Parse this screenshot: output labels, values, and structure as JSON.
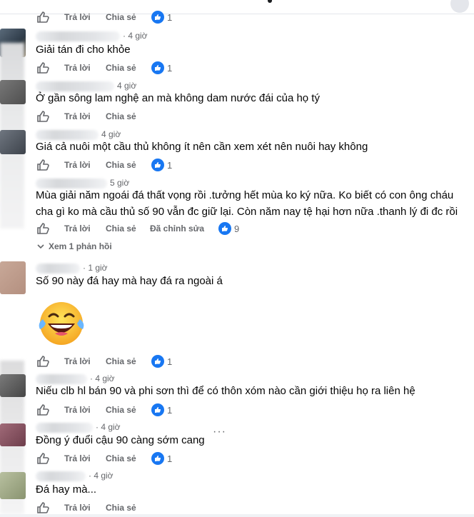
{
  "actions": {
    "reply": "Trả lời",
    "share": "Chia sẻ",
    "edited": "Đã chỉnh sửa"
  },
  "top": {
    "like_count": "1"
  },
  "comments": [
    {
      "time": "· 4 giờ",
      "text": "Giải tán đi cho khỏe",
      "likes": "1"
    },
    {
      "time": "4 giờ",
      "text": "Ở gần sông lam nghệ an mà không dam nước đái của họ tý",
      "likes": ""
    },
    {
      "time": "4 giờ",
      "text": "Giá cả nuôi một cầu thủ không ít nên cần xem xét nên nuôi hay không",
      "likes": "1"
    },
    {
      "time": "5 giờ",
      "text_line1": "Mùa giải năm ngoái đá thất vọng rồi .tưởng hết mùa ko ký nữa. Ko biết có con ông cháu",
      "text_line2": "cha gì ko mà cầu thủ số 90 vẫn đc giữ lại. Còn năm nay tệ hại hơn nữa .thanh lý đi đc rồi",
      "likes": "9"
    },
    {
      "time": "· 1 giờ",
      "text": "Số 90 này đá hay mà hay đá ra ngoài á",
      "likes": "1"
    },
    {
      "time": "· 4 giờ",
      "text": "Niếu clb hl bán 90 và phi sơn thì để có thôn xóm nào cần giới thiệu họ ra liên hệ",
      "likes": "1"
    },
    {
      "time": "· 4 giờ",
      "text": "Đồng ý đuổi cậu 90 càng sớm cang",
      "likes": "1"
    },
    {
      "time": "· 4 giờ",
      "text": "Đá hay mà...",
      "likes": ""
    }
  ],
  "see_replies": "Xem 1 phản hồi",
  "more": "···",
  "colors": {
    "like_blue": "#1877f2",
    "meta_gray": "#65676b",
    "text": "#050505"
  }
}
